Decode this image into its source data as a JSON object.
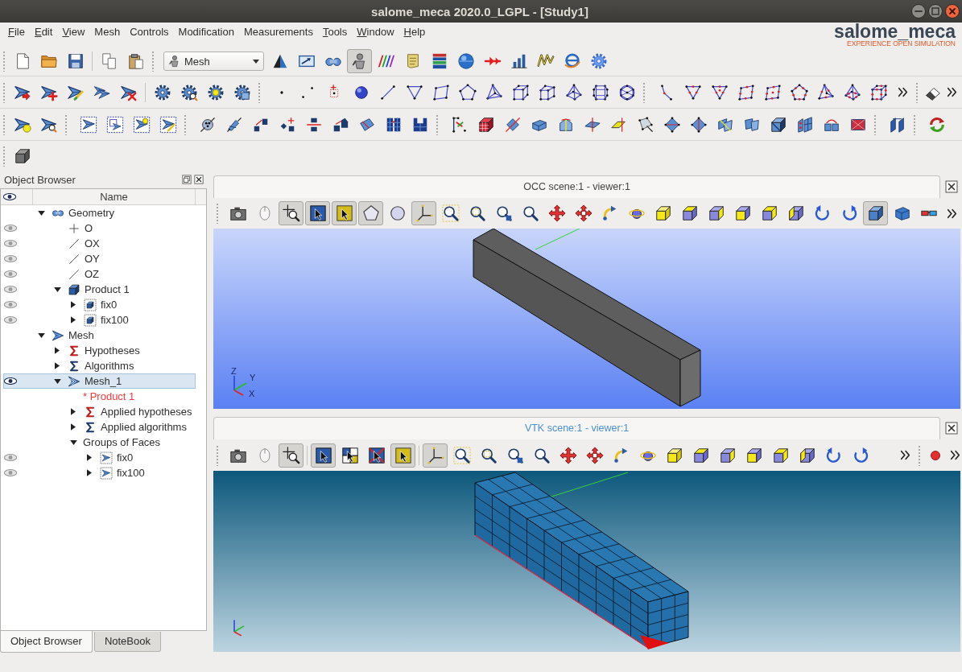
{
  "window": {
    "title": "salome_meca 2020.0_LGPL - [Study1]"
  },
  "menu": [
    {
      "label": "File",
      "mnemonic": true
    },
    {
      "label": "Edit",
      "mnemonic": true
    },
    {
      "label": "View",
      "mnemonic": true
    },
    {
      "label": "Mesh",
      "mnemonic": false
    },
    {
      "label": "Controls",
      "mnemonic": false
    },
    {
      "label": "Modification",
      "mnemonic": false
    },
    {
      "label": "Measurements",
      "mnemonic": false
    },
    {
      "label": "Tools",
      "mnemonic": true
    },
    {
      "label": "Window",
      "mnemonic": true
    },
    {
      "label": "Help",
      "mnemonic": true
    }
  ],
  "logo": {
    "title": "salome_meca",
    "tagline": "EXPERIENCE OPEN SIMULATION"
  },
  "module_toolbar": {
    "module": "Mesh",
    "modules": [
      {
        "pressed": false
      },
      {
        "pressed": false
      },
      {
        "pressed": false
      },
      {
        "pressed": true
      },
      {
        "pressed": false
      },
      {
        "pressed": false
      },
      {
        "pressed": false
      },
      {
        "pressed": false
      },
      {
        "pressed": false
      },
      {
        "pressed": false
      },
      {
        "pressed": false
      },
      {
        "pressed": false
      },
      {
        "pressed": false
      }
    ]
  },
  "object_browser": {
    "title": "Object Browser",
    "columns": [
      "Name"
    ],
    "tree": [
      {
        "label": "Geometry",
        "kind": "geometry",
        "expanded": true,
        "selected": false,
        "children": [
          {
            "label": "O",
            "kind": "point",
            "visible": false,
            "selected": false
          },
          {
            "label": "OX",
            "kind": "vector",
            "visible": false,
            "selected": false
          },
          {
            "label": "OY",
            "kind": "vector",
            "visible": false,
            "selected": false
          },
          {
            "label": "OZ",
            "kind": "vector",
            "visible": false,
            "selected": false
          },
          {
            "label": "Product 1",
            "kind": "solid",
            "visible": false,
            "expanded": true,
            "selected": false,
            "children": [
              {
                "label": "fix0",
                "kind": "group",
                "visible": false,
                "expanded": false,
                "selected": false
              },
              {
                "label": "fix100",
                "kind": "group",
                "visible": false,
                "expanded": false,
                "selected": false
              }
            ]
          }
        ]
      },
      {
        "label": "Mesh",
        "kind": "smesh",
        "expanded": true,
        "selected": false,
        "children": [
          {
            "label": "Hypotheses",
            "kind": "hypotheses",
            "expanded": false,
            "selected": false
          },
          {
            "label": "Algorithms",
            "kind": "algorithms",
            "expanded": false,
            "selected": false
          },
          {
            "label": "Mesh_1",
            "kind": "mesh",
            "visible": true,
            "expanded": true,
            "selected": true,
            "children": [
              {
                "label": "* Product 1",
                "kind": "reference",
                "selected": false
              },
              {
                "label": "Applied hypotheses",
                "kind": "hypotheses",
                "expanded": false,
                "selected": false
              },
              {
                "label": "Applied algorithms",
                "kind": "algorithms",
                "expanded": false,
                "selected": false
              },
              {
                "label": "Groups of Faces",
                "kind": "folder",
                "expanded": true,
                "selected": false,
                "children": [
                  {
                    "label": "fix0",
                    "kind": "facegroup",
                    "visible": false,
                    "expanded": false,
                    "selected": false
                  },
                  {
                    "label": "fix100",
                    "kind": "facegroup",
                    "visible": false,
                    "expanded": false,
                    "selected": false
                  }
                ]
              }
            ]
          }
        ]
      }
    ],
    "tabs": [
      {
        "label": "Object Browser",
        "selected": true
      },
      {
        "label": "NoteBook",
        "selected": false
      }
    ]
  },
  "viewers": [
    {
      "kind": "occ",
      "title": "OCC scene:1 - viewer:1",
      "active": false,
      "axis_labels": [
        "Z",
        "Y",
        "X"
      ],
      "tools": [
        {
          "pressed": false
        },
        {
          "pressed": false
        },
        {
          "pressed": true
        },
        {
          "pressed": true
        },
        {
          "pressed": true
        },
        {
          "pressed": true
        },
        {
          "pressed": false
        },
        {
          "pressed": true
        },
        {
          "pressed": false
        },
        {
          "pressed": false
        },
        {
          "pressed": false
        },
        {
          "pressed": false
        },
        {
          "pressed": false
        },
        {
          "pressed": false
        },
        {
          "pressed": false
        },
        {
          "pressed": false
        },
        {
          "pressed": false
        },
        {
          "pressed": false
        },
        {
          "pressed": false
        },
        {
          "pressed": false
        },
        {
          "pressed": false
        },
        {
          "pressed": false
        },
        {
          "pressed": false
        },
        {
          "pressed": false
        },
        {
          "pressed": true
        },
        {
          "pressed": false
        },
        {
          "pressed": false
        }
      ]
    },
    {
      "kind": "vtk",
      "title": "VTK scene:1 - viewer:1",
      "active": true,
      "tools": [
        {
          "pressed": false
        },
        {
          "pressed": false
        },
        {
          "pressed": true
        },
        {
          "pressed": true
        },
        {
          "pressed": false
        },
        {
          "pressed": false
        },
        {
          "pressed": true
        },
        {
          "pressed": true
        },
        {
          "pressed": false
        },
        {
          "pressed": false
        },
        {
          "pressed": false
        },
        {
          "pressed": false
        },
        {
          "pressed": false
        },
        {
          "pressed": false
        },
        {
          "pressed": false
        },
        {
          "pressed": false
        },
        {
          "pressed": false
        },
        {
          "pressed": false
        },
        {
          "pressed": false
        },
        {
          "pressed": false
        },
        {
          "pressed": false
        },
        {
          "pressed": false
        },
        {
          "pressed": false
        },
        {
          "pressed": false
        },
        {
          "pressed": false
        }
      ]
    }
  ]
}
